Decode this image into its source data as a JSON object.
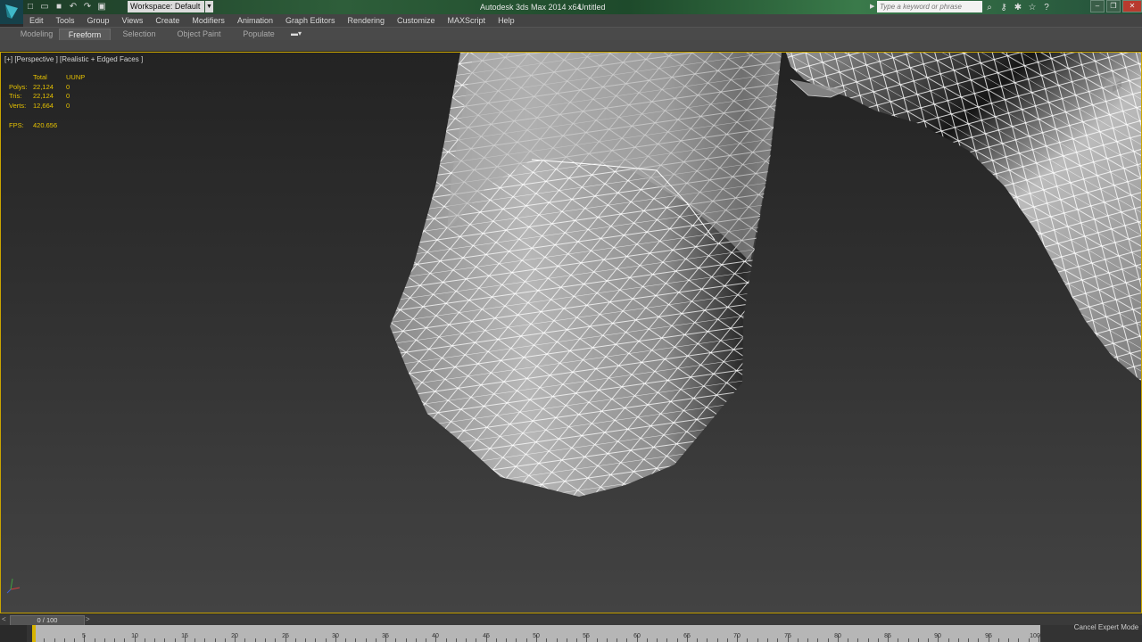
{
  "titlebar": {
    "workspace": "Workspace: Default",
    "app_title": "Autodesk 3ds Max  2014 x64",
    "doc_title": "Untitled",
    "search_placeholder": "Type a keyword or phrase",
    "window_controls": [
      "minimize",
      "restore",
      "close"
    ]
  },
  "menu": [
    "Edit",
    "Tools",
    "Group",
    "Views",
    "Create",
    "Modifiers",
    "Animation",
    "Graph Editors",
    "Rendering",
    "Customize",
    "MAXScript",
    "Help"
  ],
  "ribbon": {
    "tabs": [
      "Modeling",
      "Freeform",
      "Selection",
      "Object Paint",
      "Populate"
    ],
    "active_tab": "Freeform"
  },
  "viewport": {
    "label": "[+] [Perspective ] [Realistic + Edged Faces ]",
    "stats": {
      "headers": [
        "Total",
        "UUNP"
      ],
      "rows": [
        {
          "label": "Polys:",
          "total": "22,124",
          "sel": "0"
        },
        {
          "label": "Tris:",
          "total": "22,124",
          "sel": "0"
        },
        {
          "label": "Verts:",
          "total": "12,664",
          "sel": "0"
        }
      ],
      "fps_label": "FPS:",
      "fps_value": "420.656"
    },
    "border_color": "#c9a400"
  },
  "timeline": {
    "frame_display": "0 / 100",
    "ticks": [
      "5",
      "10",
      "15",
      "20",
      "25",
      "30",
      "35",
      "40",
      "45",
      "50",
      "55",
      "60",
      "65",
      "70",
      "75",
      "80",
      "85",
      "90",
      "95",
      "100"
    ],
    "cancel_expert": "Cancel Expert Mode"
  }
}
